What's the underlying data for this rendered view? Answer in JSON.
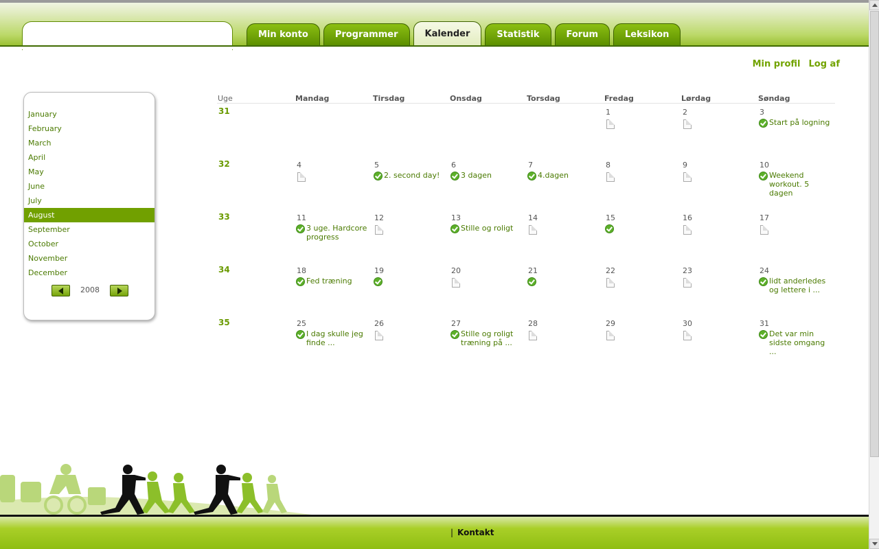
{
  "nav": {
    "tabs": [
      {
        "label": "Min konto",
        "active": false
      },
      {
        "label": "Programmer",
        "active": false
      },
      {
        "label": "Kalender",
        "active": true
      },
      {
        "label": "Statistik",
        "active": false
      },
      {
        "label": "Forum",
        "active": false
      },
      {
        "label": "Leksikon",
        "active": false
      }
    ]
  },
  "profile": {
    "profile_label": "Min profil",
    "logout_label": "Log af"
  },
  "months": {
    "items": [
      "January",
      "February",
      "March",
      "April",
      "May",
      "June",
      "July",
      "August",
      "September",
      "October",
      "November",
      "December"
    ],
    "selected": "August",
    "year": "2008"
  },
  "calendar": {
    "week_header": "Uge",
    "day_headers": [
      "Mandag",
      "Tirsdag",
      "Onsdag",
      "Torsdag",
      "Fredag",
      "Lørdag",
      "Søndag"
    ],
    "weeks": [
      {
        "number": "31",
        "days": [
          null,
          null,
          null,
          null,
          {
            "date": "1",
            "status": "empty"
          },
          {
            "date": "2",
            "status": "empty"
          },
          {
            "date": "3",
            "status": "done",
            "text": "Start på logning"
          }
        ]
      },
      {
        "number": "32",
        "days": [
          {
            "date": "4",
            "status": "empty"
          },
          {
            "date": "5",
            "status": "done",
            "text": "2. second day!"
          },
          {
            "date": "6",
            "status": "done",
            "text": "3 dagen"
          },
          {
            "date": "7",
            "status": "done",
            "text": "4.dagen"
          },
          {
            "date": "8",
            "status": "empty"
          },
          {
            "date": "9",
            "status": "empty"
          },
          {
            "date": "10",
            "status": "done",
            "text": "Weekend workout. 5 dagen"
          }
        ]
      },
      {
        "number": "33",
        "days": [
          {
            "date": "11",
            "status": "done",
            "text": "3 uge. Hardcore progress"
          },
          {
            "date": "12",
            "status": "empty"
          },
          {
            "date": "13",
            "status": "done",
            "text": "Stille og roligt"
          },
          {
            "date": "14",
            "status": "empty"
          },
          {
            "date": "15",
            "status": "done",
            "text": ""
          },
          {
            "date": "16",
            "status": "empty"
          },
          {
            "date": "17",
            "status": "empty"
          }
        ]
      },
      {
        "number": "34",
        "days": [
          {
            "date": "18",
            "status": "done",
            "text": "Fed træning"
          },
          {
            "date": "19",
            "status": "done",
            "text": ""
          },
          {
            "date": "20",
            "status": "empty"
          },
          {
            "date": "21",
            "status": "done",
            "text": ""
          },
          {
            "date": "22",
            "status": "empty"
          },
          {
            "date": "23",
            "status": "empty"
          },
          {
            "date": "24",
            "status": "done",
            "text": "lidt anderledes og lettere i ..."
          }
        ]
      },
      {
        "number": "35",
        "days": [
          {
            "date": "25",
            "status": "done",
            "text": "I dag skulle jeg finde ..."
          },
          {
            "date": "26",
            "status": "empty"
          },
          {
            "date": "27",
            "status": "done",
            "text": "Stille og roligt træning på ..."
          },
          {
            "date": "28",
            "status": "empty"
          },
          {
            "date": "29",
            "status": "empty"
          },
          {
            "date": "30",
            "status": "empty"
          },
          {
            "date": "31",
            "status": "done",
            "text": "Det var min sidste omgang ..."
          }
        ]
      }
    ]
  },
  "footer": {
    "separator": "|",
    "contact_label": "Kontakt"
  },
  "colors": {
    "brand_green": "#71a000",
    "link_green": "#4a7a00",
    "check_green": "#5db02a"
  }
}
